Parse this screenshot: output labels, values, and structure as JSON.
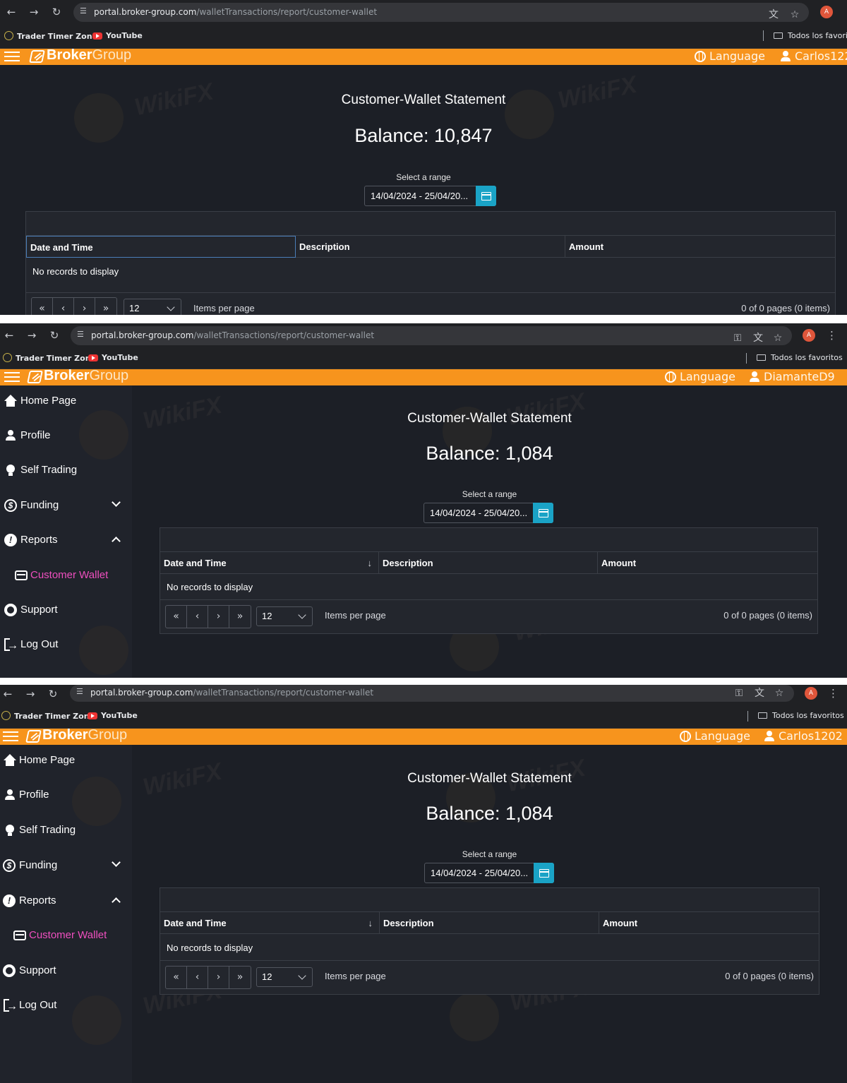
{
  "screenshots": [
    {
      "url_host": "portal.broker-group.com",
      "url_path": "/walletTransactions/report/customer-wallet",
      "bookmarks": [
        "Trader Timer Zone",
        "YouTube"
      ],
      "favorites_folder": "Todos los favorit",
      "brand_bold": "Broker",
      "brand_light": "Group",
      "language_label": "Language",
      "username": "Carlos122",
      "title": "Customer-Wallet Statement",
      "balance": "Balance: 10,847",
      "range_label": "Select a range",
      "date_range": "14/04/2024 - 25/04/20...",
      "columns": [
        "Date and Time",
        "Description",
        "Amount"
      ],
      "empty_text": "No records to display",
      "pager_buttons": [
        "«",
        "‹",
        "›",
        "»"
      ],
      "page_size": "12",
      "items_per_page": "Items per page",
      "page_info": "0 of 0 pages (0 items)"
    },
    {
      "url_host": "portal.broker-group.com",
      "url_path": "/walletTransactions/report/customer-wallet",
      "bookmarks": [
        "Trader Timer Zone",
        "YouTube"
      ],
      "favorites_folder": "Todos los favoritos",
      "brand_bold": "Broker",
      "brand_light": "Group",
      "language_label": "Language",
      "username": "DiamanteD9",
      "sidebar": [
        "Home Page",
        "Profile",
        "Self Trading",
        "Funding",
        "Reports",
        "Customer Wallet",
        "Support",
        "Log Out"
      ],
      "title": "Customer-Wallet Statement",
      "balance": "Balance: 1,084",
      "range_label": "Select a range",
      "date_range": "14/04/2024 - 25/04/20...",
      "columns": [
        "Date and Time",
        "Description",
        "Amount"
      ],
      "sort_indicator": "↓",
      "empty_text": "No records to display",
      "pager_buttons": [
        "«",
        "‹",
        "›",
        "»"
      ],
      "page_size": "12",
      "items_per_page": "Items per page",
      "page_info": "0 of 0 pages (0 items)"
    },
    {
      "url_host": "portal.broker-group.com",
      "url_path": "/walletTransactions/report/customer-wallet",
      "bookmarks": [
        "Trader Timer Zone",
        "YouTube"
      ],
      "favorites_folder": "Todos los favoritos",
      "brand_bold": "Broker",
      "brand_light": "Group",
      "language_label": "Language",
      "username": "Carlos1202",
      "sidebar": [
        "Home Page",
        "Profile",
        "Self Trading",
        "Funding",
        "Reports",
        "Customer Wallet",
        "Support",
        "Log Out"
      ],
      "title": "Customer-Wallet Statement",
      "balance": "Balance: 1,084",
      "range_label": "Select a range",
      "date_range": "14/04/2024 - 25/04/20...",
      "columns": [
        "Date and Time",
        "Description",
        "Amount"
      ],
      "sort_indicator": "↓",
      "empty_text": "No records to display",
      "pager_buttons": [
        "«",
        "‹",
        "›",
        "»"
      ],
      "page_size": "12",
      "items_per_page": "Items per page",
      "page_info": "0 of 0 pages (0 items)"
    }
  ],
  "watermark_text": "WikiFX",
  "colors": {
    "accent_orange": "#f7941d",
    "page_background": "#1c1f26",
    "sidebar_background": "#20232b",
    "active_menu_pink": "#ef4fbf",
    "calendar_button": "#1aa3c6"
  },
  "icons": [
    "back-icon",
    "forward-icon",
    "reload-icon",
    "site-settings-icon",
    "translate-icon",
    "star-icon",
    "key-icon",
    "profile-avatar-icon",
    "menu-kebab-icon",
    "hamburger-icon",
    "brand-logo-icon",
    "globe-icon",
    "user-icon",
    "home-icon",
    "profile-icon",
    "bulb-icon",
    "dollar-icon",
    "info-icon",
    "wallet-icon",
    "support-icon",
    "logout-icon",
    "calendar-icon"
  ]
}
